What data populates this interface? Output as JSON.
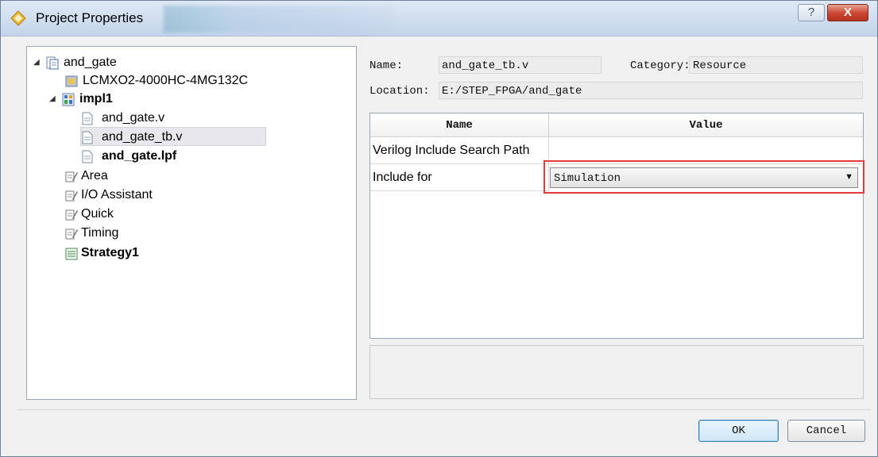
{
  "window": {
    "title": "Project Properties",
    "help_glyph": "?",
    "close_glyph": "X"
  },
  "tree": {
    "root": {
      "label": "and_gate",
      "icon": "project-icon"
    },
    "device": {
      "label": "LCMXO2-4000HC-4MG132C",
      "icon": "chip-icon"
    },
    "impl": {
      "label": "impl1",
      "icon": "implementation-icon"
    },
    "files": [
      {
        "label": "and_gate.v",
        "icon": "file-icon"
      },
      {
        "label": "and_gate_tb.v",
        "icon": "file-icon",
        "selected": true
      },
      {
        "label": "and_gate.lpf",
        "icon": "file-icon",
        "bold": true
      }
    ],
    "strategies": [
      {
        "label": "Area",
        "icon": "strategy-icon"
      },
      {
        "label": "I/O Assistant",
        "icon": "strategy-icon"
      },
      {
        "label": "Quick",
        "icon": "strategy-icon"
      },
      {
        "label": "Timing",
        "icon": "strategy-icon"
      },
      {
        "label": "Strategy1",
        "icon": "active-strategy-icon",
        "bold": true
      }
    ]
  },
  "info": {
    "name_label": "Name:",
    "name_value": "and_gate_tb.v",
    "category_label": "Category:",
    "category_value": "Resource",
    "location_label": "Location:",
    "location_value": "E:/STEP_FPGA/and_gate"
  },
  "table": {
    "col_name": "Name",
    "col_value": "Value",
    "rows": [
      {
        "name": "Verilog Include Search Path",
        "value": ""
      },
      {
        "name": "Include for",
        "value": "Simulation"
      }
    ]
  },
  "buttons": {
    "ok": "OK",
    "cancel": "Cancel"
  },
  "colors": {
    "highlight_box": "#e23b3b",
    "selection": "#e8e8ec"
  }
}
